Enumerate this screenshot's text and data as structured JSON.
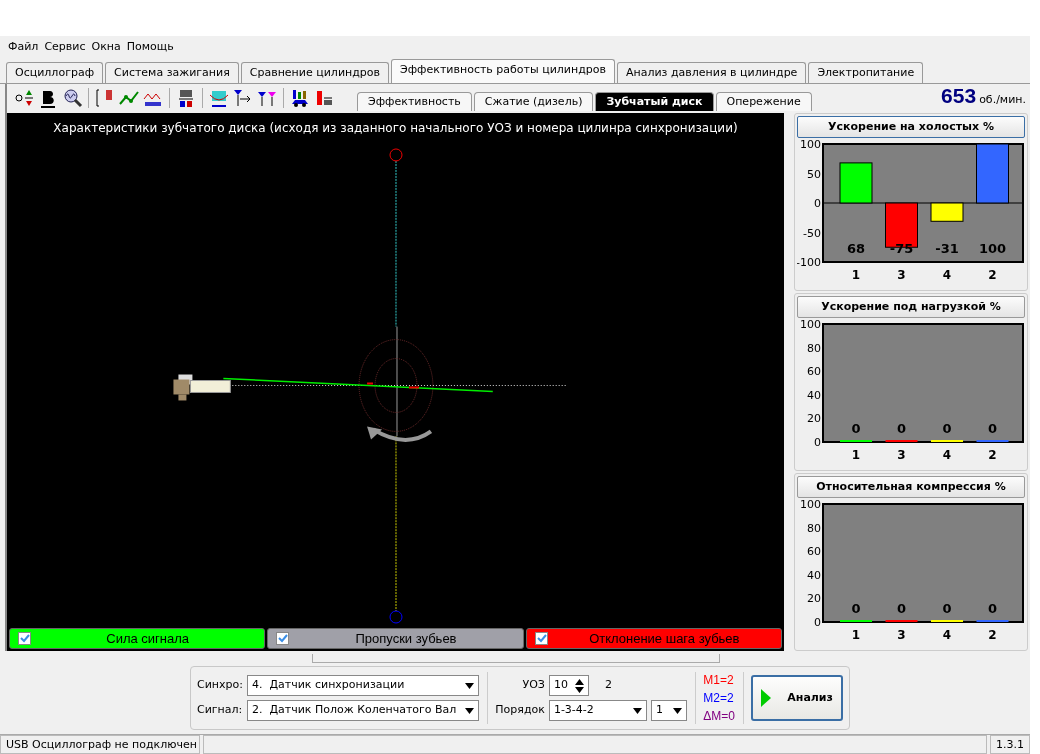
{
  "menu": [
    "Файл",
    "Сервис",
    "Окна",
    "Помощь"
  ],
  "tabs": [
    {
      "label": "Осциллограф",
      "selected": false
    },
    {
      "label": "Система зажигания",
      "selected": false
    },
    {
      "label": "Сравнение цилиндров",
      "selected": false
    },
    {
      "label": "Эффективность работы цилиндров",
      "selected": true
    },
    {
      "label": "Анализ давления в цилиндре",
      "selected": false
    },
    {
      "label": "Электропитание",
      "selected": false
    }
  ],
  "subtabs": [
    {
      "label": "Эффективность",
      "selected": false
    },
    {
      "label": "Сжатие (дизель)",
      "selected": false
    },
    {
      "label": "Зубчатый диск",
      "selected": true
    },
    {
      "label": "Опережение",
      "selected": false
    }
  ],
  "rpm": {
    "value": "653",
    "unit": "об./мин."
  },
  "canvas": {
    "title": "Характеристики зубчатого диска (исходя из заданного начального УОЗ и номера цилинра синхронизации)",
    "toggles": [
      {
        "label": "Сила сигнала",
        "checked": true,
        "color": "#00ff00"
      },
      {
        "label": "Пропуски зубьев",
        "checked": true,
        "color": "#a0a0a8"
      },
      {
        "label": "Отклонение шага зубьев",
        "checked": true,
        "color": "#ff0000"
      }
    ]
  },
  "panels": [
    {
      "title": "Ускорение на холостых %",
      "selected": true,
      "bars": [
        {
          "color": "#00ff00"
        },
        {
          "color": "#ff0000"
        },
        {
          "color": "#ffff00"
        },
        {
          "color": "#3366ff"
        }
      ],
      "chart_data": {
        "type": "bar",
        "categories": [
          "1",
          "3",
          "4",
          "2"
        ],
        "series": [
          {
            "values": [
              68,
              -75,
              -31,
              100
            ]
          }
        ],
        "ylim": [
          -100,
          100
        ],
        "yticks": [
          -100,
          -50,
          0,
          50,
          100
        ],
        "data_labels": true
      }
    },
    {
      "title": "Ускорение под нагрузкой %",
      "selected": false,
      "bars": [
        {
          "color": "#00ff00"
        },
        {
          "color": "#ff0000"
        },
        {
          "color": "#ffff00"
        },
        {
          "color": "#3366ff"
        }
      ],
      "chart_data": {
        "type": "bar",
        "categories": [
          "1",
          "3",
          "4",
          "2"
        ],
        "series": [
          {
            "values": [
              0,
              0,
              0,
              0
            ]
          }
        ],
        "ylim": [
          0,
          100
        ],
        "yticks": [
          0,
          20,
          40,
          60,
          80,
          100
        ],
        "data_labels": true
      }
    },
    {
      "title": "Относительная компрессия %",
      "selected": false,
      "bars": [
        {
          "color": "#00ff00"
        },
        {
          "color": "#ff0000"
        },
        {
          "color": "#ffff00"
        },
        {
          "color": "#3366ff"
        }
      ],
      "chart_data": {
        "type": "bar",
        "categories": [
          "1",
          "3",
          "4",
          "2"
        ],
        "series": [
          {
            "values": [
              0,
              0,
              0,
              0
            ]
          }
        ],
        "ylim": [
          0,
          100
        ],
        "yticks": [
          0,
          20,
          40,
          60,
          80,
          100
        ],
        "data_labels": true
      }
    }
  ],
  "controls": {
    "sync": {
      "label": "Синхро:",
      "value": "4.  Датчик синхронизации"
    },
    "signal": {
      "label": "Сигнал:",
      "value": "2.  Датчик Полож Коленчатого Вал"
    },
    "uoz": {
      "label": "УОЗ",
      "value": "10",
      "note": "2"
    },
    "order": {
      "label": "Порядок",
      "value": "1-3-4-2",
      "cylinder": "1"
    },
    "metrics": [
      {
        "text": "M1=2",
        "color": "#ff0000"
      },
      {
        "text": "M2=2",
        "color": "#0000ff"
      },
      {
        "text": "ΔM=0",
        "color": "#800080"
      }
    ],
    "analyze_button": "Анализ"
  },
  "status_bar": {
    "message": "USB Осциллограф не подключен",
    "version": "1.3.1"
  }
}
